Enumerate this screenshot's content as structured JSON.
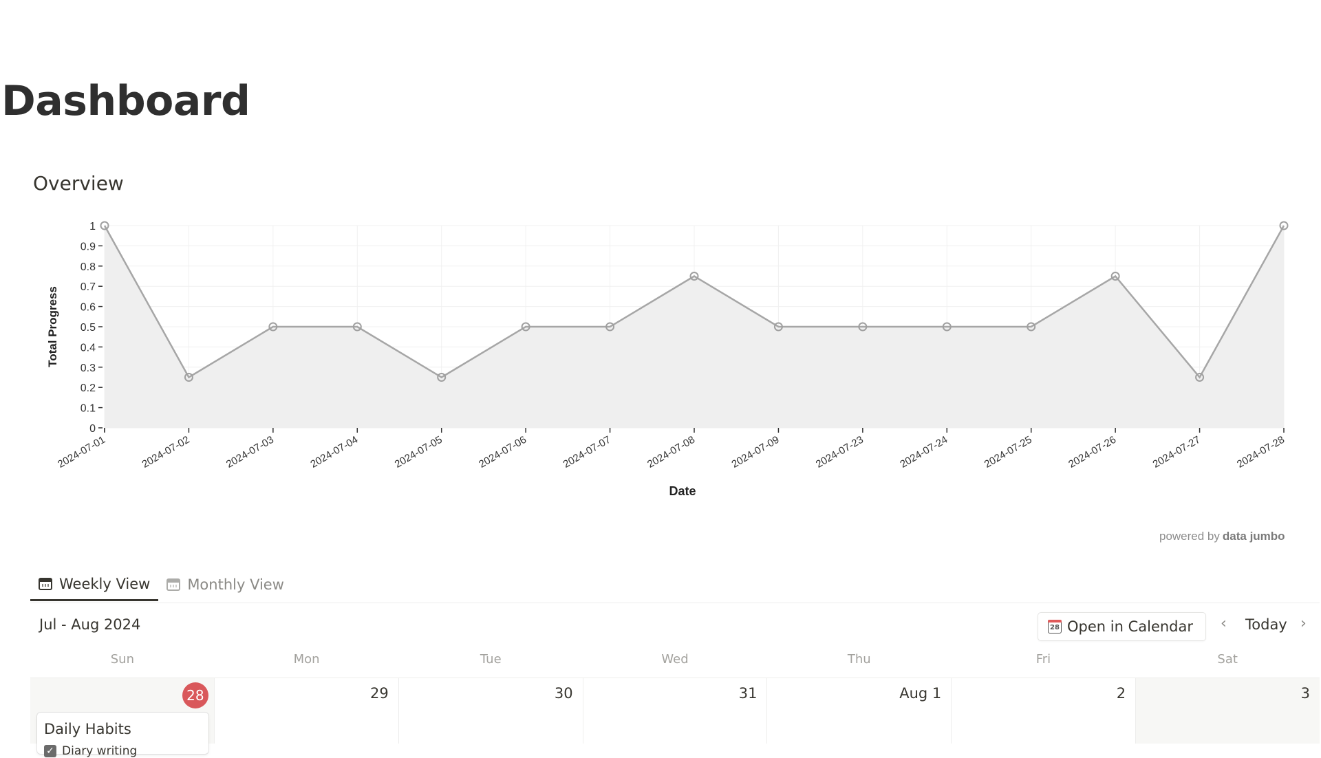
{
  "page": {
    "title": "Dashboard"
  },
  "overview": {
    "title": "Overview",
    "powered_by": "powered by",
    "powered_brand": "data jumbo"
  },
  "chart_data": {
    "type": "area",
    "title": "",
    "xlabel": "Date",
    "ylabel": "Total Progress",
    "ylim": [
      0,
      1
    ],
    "yticks": [
      0,
      0.1,
      0.2,
      0.3,
      0.4,
      0.5,
      0.6,
      0.7,
      0.8,
      0.9,
      1
    ],
    "ytick_labels": [
      "0",
      "0.1",
      "0.2",
      "0.3",
      "0.4",
      "0.5",
      "0.6",
      "0.7",
      "0.8",
      "0.9",
      "1"
    ],
    "grid": true,
    "x": [
      "2024-07-01",
      "2024-07-02",
      "2024-07-03",
      "2024-07-04",
      "2024-07-05",
      "2024-07-06",
      "2024-07-07",
      "2024-07-08",
      "2024-07-09",
      "2024-07-23",
      "2024-07-24",
      "2024-07-25",
      "2024-07-26",
      "2024-07-27",
      "2024-07-28"
    ],
    "series": [
      {
        "name": "Total Progress",
        "values": [
          1,
          0.25,
          0.5,
          0.5,
          0.25,
          0.5,
          0.5,
          0.75,
          0.5,
          0.5,
          0.5,
          0.5,
          0.75,
          0.25,
          1
        ],
        "color": "#a6a6a6",
        "fill": "#efefef"
      }
    ]
  },
  "tabs": [
    {
      "label": "Weekly View",
      "icon": "calendar-icon",
      "active": true
    },
    {
      "label": "Monthly View",
      "icon": "calendar-icon",
      "active": false
    }
  ],
  "calendar": {
    "range_label": "Jul - Aug 2024",
    "open_button": "Open in Calendar",
    "open_icon_day": "28",
    "prev_icon": "‹",
    "today_label": "Today",
    "next_icon": "›",
    "weekdays": [
      "Sun",
      "Mon",
      "Tue",
      "Wed",
      "Thu",
      "Fri",
      "Sat"
    ],
    "days": [
      "28",
      "29",
      "30",
      "31",
      "Aug 1",
      "2",
      "3"
    ],
    "today_index": 0,
    "today_color": "#d9585b",
    "event": {
      "title": "Daily Habits",
      "item": "Diary writing",
      "checked": true
    }
  }
}
